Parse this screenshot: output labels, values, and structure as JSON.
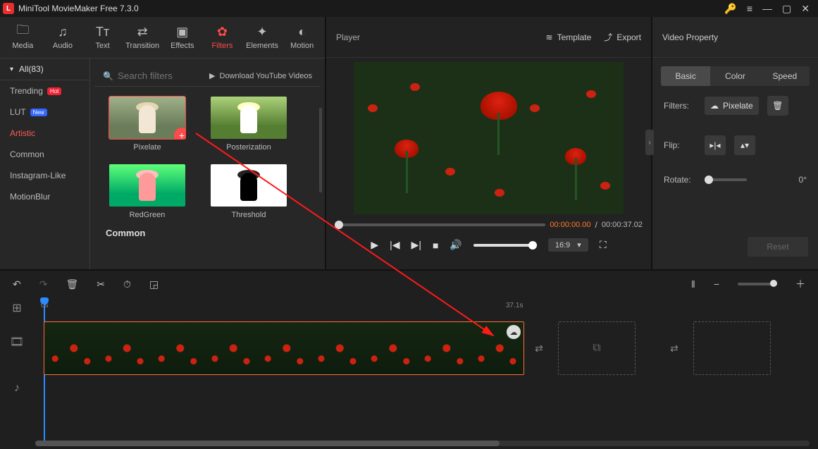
{
  "titlebar": {
    "app_title": "MiniTool MovieMaker Free 7.3.0"
  },
  "top_tabs": {
    "media": "Media",
    "audio": "Audio",
    "text": "Text",
    "transition": "Transition",
    "effects": "Effects",
    "filters": "Filters",
    "elements": "Elements",
    "motion": "Motion",
    "active": "Filters"
  },
  "filters_sidebar": {
    "all_label": "All(83)",
    "categories": [
      {
        "label": "Trending",
        "badge": "Hot"
      },
      {
        "label": "LUT",
        "badge": "New"
      },
      {
        "label": "Artistic",
        "active": true
      },
      {
        "label": "Common"
      },
      {
        "label": "Instagram-Like"
      },
      {
        "label": "MotionBlur"
      }
    ]
  },
  "filters_panel": {
    "search_placeholder": "Search filters",
    "download_label": "Download YouTube Videos",
    "items": [
      {
        "label": "Pixelate",
        "selected": true
      },
      {
        "label": "Posterization"
      },
      {
        "label": "RedGreen"
      },
      {
        "label": "Threshold"
      }
    ],
    "next_section": "Common"
  },
  "player": {
    "heading": "Player",
    "template_btn": "Template",
    "export_btn": "Export",
    "time_current": "00:00:00.00",
    "time_sep": " / ",
    "time_total": "00:00:37.02",
    "aspect": "16:9"
  },
  "props": {
    "heading": "Video Property",
    "tabs": {
      "basic": "Basic",
      "color": "Color",
      "speed": "Speed",
      "active": "Basic"
    },
    "filters_label": "Filters:",
    "filters_value": "Pixelate",
    "flip_label": "Flip:",
    "rotate_label": "Rotate:",
    "rotate_value": "0°",
    "reset_label": "Reset"
  },
  "timeline": {
    "ruler": {
      "start": "0s",
      "mark": "37.1s"
    }
  }
}
